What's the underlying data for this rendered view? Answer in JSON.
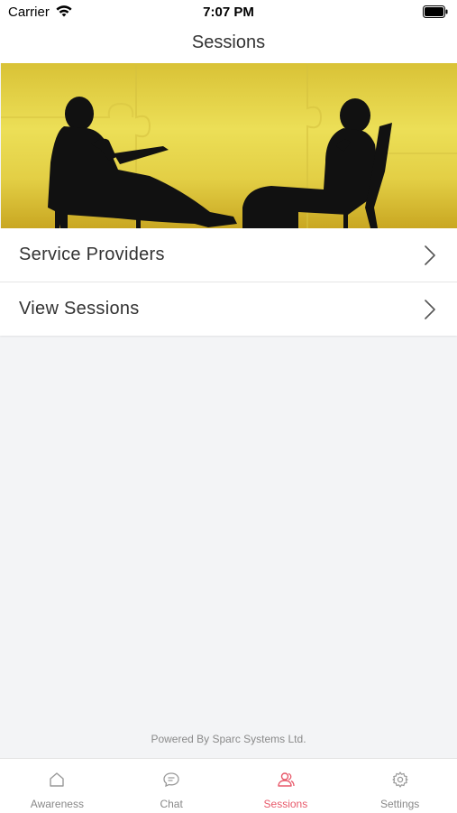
{
  "status_bar": {
    "carrier": "Carrier",
    "time": "7:07 PM"
  },
  "header": {
    "title": "Sessions"
  },
  "menu": {
    "items": [
      {
        "label": "Service Providers"
      },
      {
        "label": "View Sessions"
      }
    ]
  },
  "footer": {
    "powered_by": "Powered By Sparc Systems Ltd."
  },
  "tab_bar": {
    "tabs": [
      {
        "label": "Awareness",
        "icon": "home-icon",
        "active": false
      },
      {
        "label": "Chat",
        "icon": "chat-icon",
        "active": false
      },
      {
        "label": "Sessions",
        "icon": "users-icon",
        "active": true
      },
      {
        "label": "Settings",
        "icon": "gear-icon",
        "active": false
      }
    ]
  },
  "colors": {
    "accent": "#e8596a",
    "background": "#f3f4f6",
    "banner": "#e6d650"
  }
}
